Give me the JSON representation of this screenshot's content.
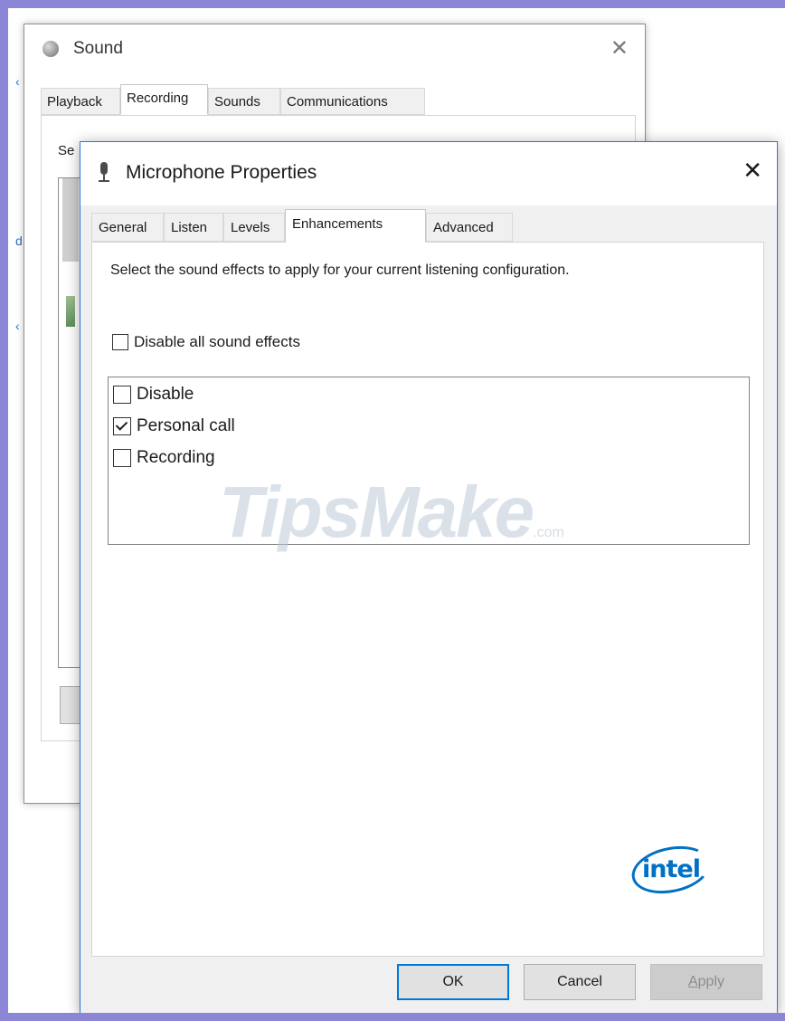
{
  "sound_dialog": {
    "title": "Sound",
    "close_glyph": "✕",
    "tabs": [
      "Playback",
      "Recording",
      "Sounds",
      "Communications"
    ],
    "active_tab": "Recording",
    "partial_text": "Se"
  },
  "mic_dialog": {
    "title": "Microphone Properties",
    "close_glyph": "✕",
    "tabs": [
      "General",
      "Listen",
      "Levels",
      "Enhancements",
      "Advanced"
    ],
    "active_tab": "Enhancements",
    "description": "Select the sound effects to apply for your current listening configuration.",
    "disable_all": {
      "label": "Disable all sound effects",
      "checked": false
    },
    "effects": [
      {
        "label": "Disable",
        "checked": false
      },
      {
        "label": "Personal call",
        "checked": true
      },
      {
        "label": "Recording",
        "checked": false
      }
    ],
    "logo": "intel",
    "buttons": {
      "ok": "OK",
      "cancel": "Cancel",
      "apply_prefix": "",
      "apply_underlined": "A",
      "apply_rest": "pply"
    }
  },
  "watermark": {
    "main": "TipsMake",
    "suffix": ".com"
  },
  "colors": {
    "accent": "#0078d7",
    "frame": "#8b86d6",
    "intel_blue": "#0071c5"
  }
}
